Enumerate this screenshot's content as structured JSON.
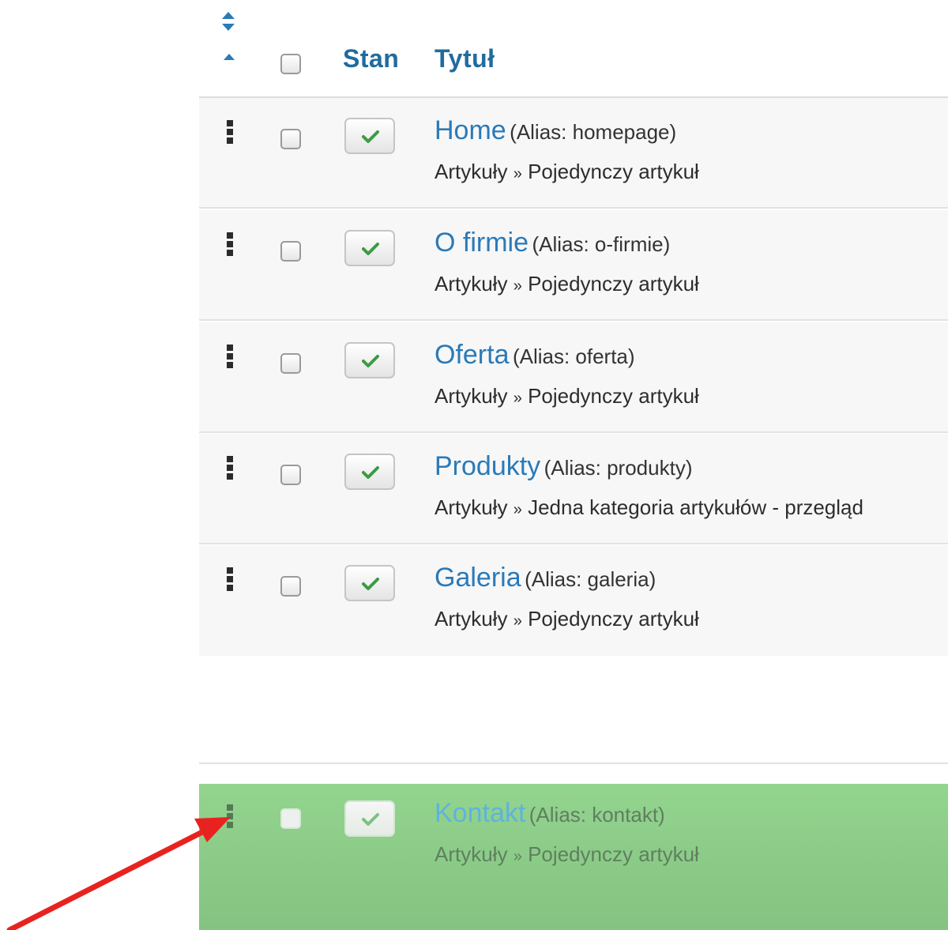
{
  "header": {
    "status_label": "Stan",
    "title_label": "Tytuł",
    "sort_icon": "sort-icon",
    "sort_asc_icon": "caret-up-icon"
  },
  "colors": {
    "link": "#2a7ab8",
    "header": "#1f6b9e",
    "published_check": "#3c9a45",
    "drag_row_bg": "#8ccb88",
    "annotation_arrow": "#e8231f"
  },
  "rows": [
    {
      "title": "Home",
      "alias": "(Alias: homepage)",
      "type_prefix": "Artykuły",
      "separator": "»",
      "type": "Pojedynczy artykuł",
      "published": true
    },
    {
      "title": "O firmie",
      "alias": "(Alias: o-firmie)",
      "type_prefix": "Artykuły",
      "separator": "»",
      "type": "Pojedynczy artykuł",
      "published": true
    },
    {
      "title": "Oferta",
      "alias": "(Alias: oferta)",
      "type_prefix": "Artykuły",
      "separator": "»",
      "type": "Pojedynczy artykuł",
      "published": true
    },
    {
      "title": "Produkty",
      "alias": "(Alias: produkty)",
      "type_prefix": "Artykuły",
      "separator": "»",
      "type": "Jedna kategoria artykułów - przegląd",
      "published": true
    },
    {
      "title": "Galeria",
      "alias": "(Alias: galeria)",
      "type_prefix": "Artykuły",
      "separator": "»",
      "type": "Pojedynczy artykuł",
      "published": true
    }
  ],
  "dragged_row": {
    "title": "Kontakt",
    "alias": "(Alias: kontakt)",
    "type_prefix": "Artykuły",
    "separator": "»",
    "type": "Pojedynczy artykuł",
    "published": true
  },
  "annotation": {
    "icon": "red-arrow-icon"
  }
}
